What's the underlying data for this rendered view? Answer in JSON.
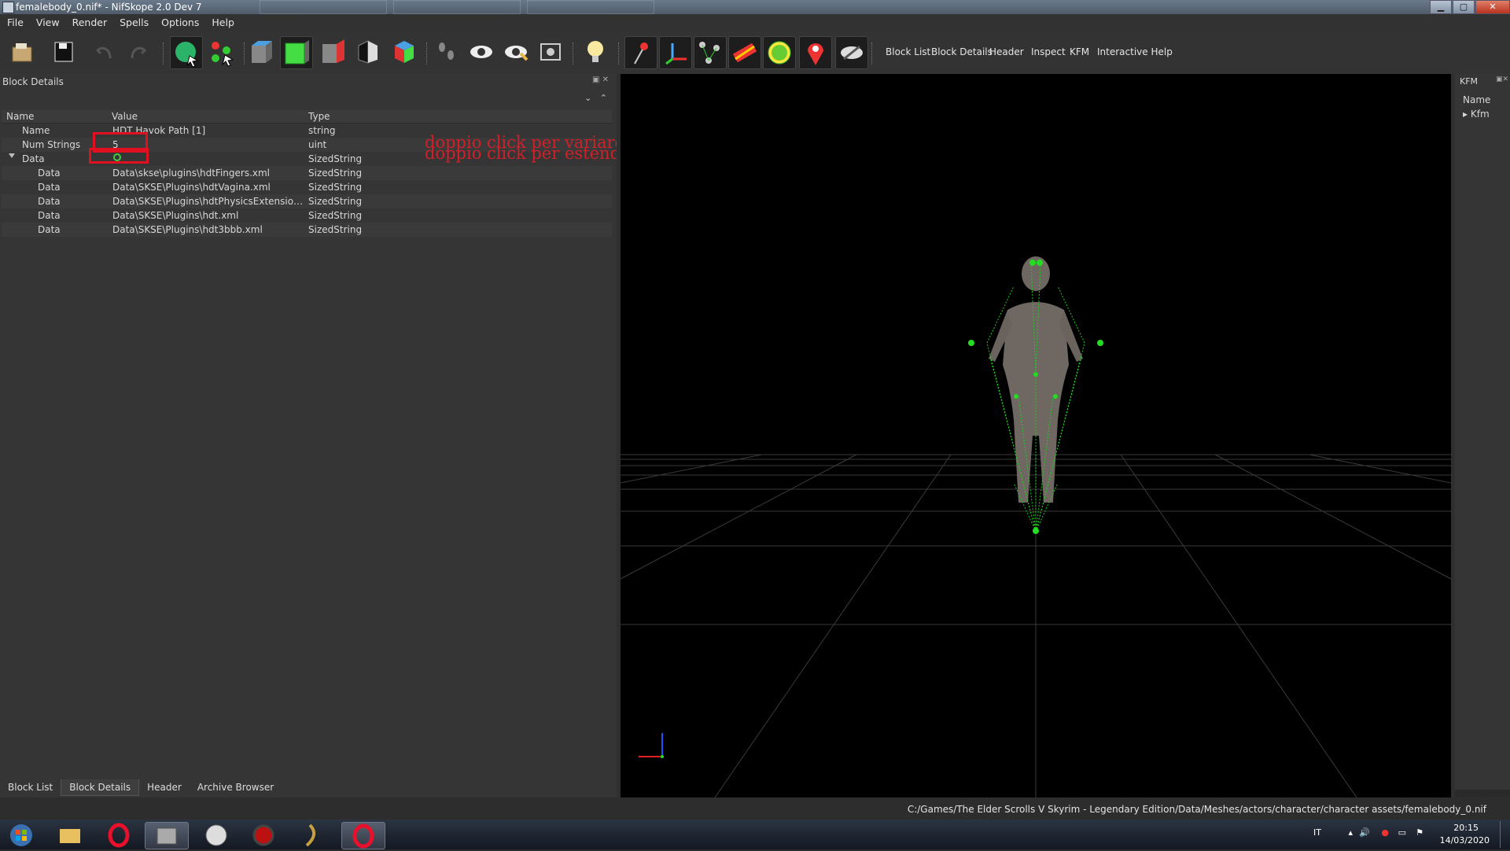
{
  "window": {
    "title": "femalebody_0.nif* - NifSkope 2.0 Dev 7",
    "minimize": "▁",
    "maximize": "▢",
    "close": "✕"
  },
  "menu": {
    "items": [
      "File",
      "View",
      "Render",
      "Spells",
      "Options",
      "Help"
    ]
  },
  "toolbar": {
    "icons": [
      "load-icon",
      "save-icon",
      "undo-icon",
      "redo-icon",
      "select-object-icon",
      "select-vertex-icon",
      "view-top-icon",
      "view-front-icon",
      "view-side-icon",
      "view-user-icon",
      "view-walk-icon",
      "footprints-icon",
      "eye-icon",
      "eye-show-icon",
      "screenshot-icon",
      "light-bulb-icon",
      "pin-icon",
      "axes-icon",
      "nodes-icon",
      "constraints-icon",
      "havok-icon",
      "marker-icon",
      "hidden-icon"
    ],
    "tabs": [
      "Block List",
      "Block Details",
      "Header",
      "Inspect",
      "KFM",
      "Interactive Help"
    ]
  },
  "block_details": {
    "title": "Block Details",
    "columns": [
      "Name",
      "Value",
      "Type"
    ],
    "rows": [
      {
        "name": "Name",
        "value": "HDT Havok Path [1]",
        "type": "string"
      },
      {
        "name": "Num Strings",
        "value": "5",
        "type": "uint"
      },
      {
        "name": "Data",
        "value": "",
        "type": "SizedString"
      },
      {
        "name": "Data",
        "value": "Data\\skse\\plugins\\hdtFingers.xml",
        "type": "SizedString"
      },
      {
        "name": "Data",
        "value": "Data\\SKSE\\Plugins\\hdtVagina.xml",
        "type": "SizedString"
      },
      {
        "name": "Data",
        "value": "Data\\SKSE\\Plugins\\hdtPhysicsExtensionsDef...",
        "type": "SizedString"
      },
      {
        "name": "Data",
        "value": "Data\\SKSE\\Plugins\\hdt.xml",
        "type": "SizedString"
      },
      {
        "name": "Data",
        "value": "Data\\SKSE\\Plugins\\hdt3bbb.xml",
        "type": "SizedString"
      }
    ]
  },
  "annotations": {
    "line1": "doppio click per variare il numero di stringhe",
    "line2": "doppio click per estendere il menu a tendina"
  },
  "bottom_tabs": [
    "Block List",
    "Block Details",
    "Header",
    "Archive Browser"
  ],
  "kfm": {
    "title": "KFM",
    "column": "Name",
    "item": "Kfm"
  },
  "status": {
    "path": "C:/Games/The Elder Scrolls V Skyrim - Legendary Edition/Data/Meshes/actors/character/character assets/femalebody_0.nif"
  },
  "taskbar": {
    "apps": [
      "windows-start-icon",
      "file-explorer-icon",
      "opera-icon",
      "media-app-icon",
      "ffdec-icon",
      "gear-app-icon",
      "curve-app-icon",
      "opera-active-icon"
    ],
    "tray": {
      "lang": "IT",
      "time": "20:15",
      "date": "14/03/2020"
    }
  },
  "colors": {
    "annotation": "#d0202a",
    "highlight_box": "#e01020",
    "bone": "#22dd22",
    "viewport_bg": "#000000"
  }
}
